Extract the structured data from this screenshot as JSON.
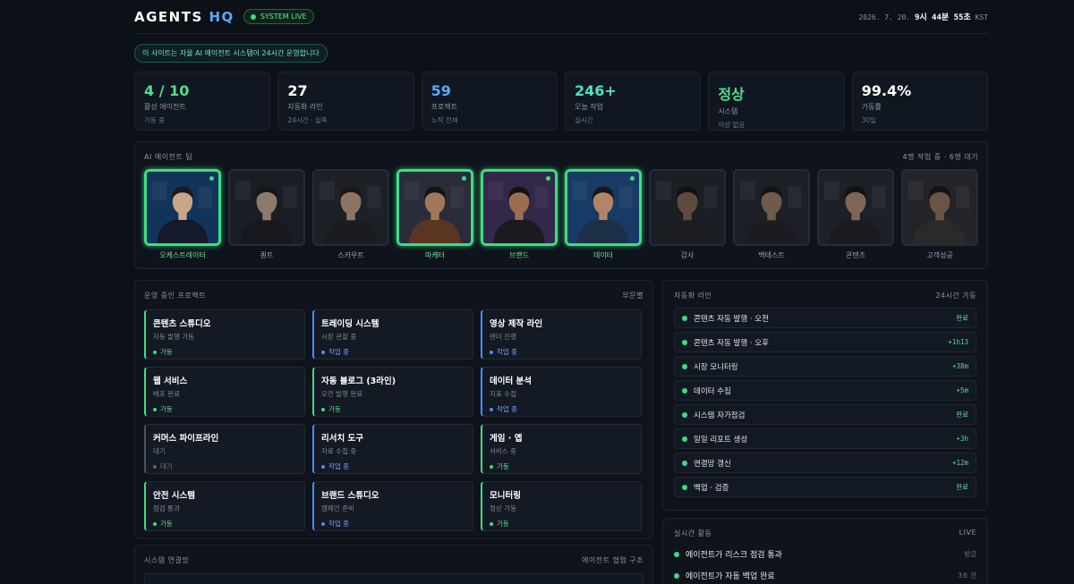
{
  "header": {
    "logo_main": "AGENTS",
    "logo_accent": "HQ",
    "live_badge": "SYSTEM LIVE",
    "clock_date": "2026. 7. 20.",
    "clock_time": "9시 44분 55초",
    "clock_tz": "KST"
  },
  "notice": "이 사이트는 자율 AI 에이전트 시스템이 24시간 운영합니다",
  "kpis": [
    {
      "value": "4 / 10",
      "label": "활성 에이전트",
      "sub": "가동 중",
      "color": "#4fe08c"
    },
    {
      "value": "27",
      "label": "자동화 라인",
      "sub": "24시간 · 실측",
      "color": "#ffffff"
    },
    {
      "value": "59",
      "label": "프로젝트",
      "sub": "누적 전체",
      "color": "#5aa8ff"
    },
    {
      "value": "246+",
      "label": "오늘 작업",
      "sub": "실시간",
      "color": "#4fe0c8"
    },
    {
      "value": "정상",
      "label": "시스템",
      "sub": "이상 없음",
      "color": "#4fe08c"
    },
    {
      "value": "99.4%",
      "label": "가동률",
      "sub": "30일",
      "color": "#ffffff"
    }
  ],
  "agents": {
    "title": "AI 에이전트 팀",
    "summary": "4명 작업 중 · 6명 대기",
    "items": [
      {
        "name": "오케스트레이터",
        "active": true,
        "skin": "#c9a58a",
        "hair": "#1a1a1f",
        "cloth": "#141a2a",
        "bg": "#13345a"
      },
      {
        "name": "퀀트",
        "active": false,
        "skin": "#8e7a6c",
        "hair": "#15161a",
        "cloth": "#16181d",
        "bg": "#1a1d24"
      },
      {
        "name": "스카우트",
        "active": false,
        "skin": "#8d7464",
        "hair": "#1d1715",
        "cloth": "#1a1c20",
        "bg": "#1d2026"
      },
      {
        "name": "마케터",
        "active": true,
        "skin": "#a3785a",
        "hair": "#161413",
        "cloth": "#5a3622",
        "bg": "#2a2c3a"
      },
      {
        "name": "브랜드",
        "active": true,
        "skin": "#9b6e52",
        "hair": "#151312",
        "cloth": "#1b1a1e",
        "bg": "#33284a"
      },
      {
        "name": "데이터",
        "active": true,
        "skin": "#b38566",
        "hair": "#17171a",
        "cloth": "#1d3048",
        "bg": "#173a66"
      },
      {
        "name": "감사",
        "active": false,
        "skin": "#5e4a3e",
        "hair": "#121212",
        "cloth": "#1c1e22",
        "bg": "#1b1e24"
      },
      {
        "name": "백테스트",
        "active": false,
        "skin": "#6f5a4c",
        "hair": "#141416",
        "cloth": "#1a1c21",
        "bg": "#1c1f25"
      },
      {
        "name": "콘텐츠",
        "active": false,
        "skin": "#7d6656",
        "hair": "#121214",
        "cloth": "#191b1f",
        "bg": "#1d2026"
      },
      {
        "name": "고객성공",
        "active": false,
        "skin": "#6a5445",
        "hair": "#131313",
        "cloth": "#2a2a2a",
        "bg": "#22242a"
      }
    ]
  },
  "projects": {
    "title": "운영 중인 프로젝트",
    "filter": "부문별",
    "items": [
      {
        "title": "콘텐츠 스튜디오",
        "desc": "자동 발행 가동",
        "status": "가동",
        "kind": "green"
      },
      {
        "title": "트레이딩 시스템",
        "desc": "시장 관찰 중",
        "status": "작업 중",
        "kind": "blue"
      },
      {
        "title": "영상 제작 라인",
        "desc": "렌더 진행",
        "status": "작업 중",
        "kind": "blue"
      },
      {
        "title": "웹 서비스",
        "desc": "배포 완료",
        "status": "가동",
        "kind": "green"
      },
      {
        "title": "자동 블로그 (3라인)",
        "desc": "오전 발행 완료",
        "status": "가동",
        "kind": "green"
      },
      {
        "title": "데이터 분석",
        "desc": "지표 수집",
        "status": "작업 중",
        "kind": "blue"
      },
      {
        "title": "커머스 파이프라인",
        "desc": "대기",
        "status": "대기",
        "kind": "grey"
      },
      {
        "title": "리서치 도구",
        "desc": "자료 수집 중",
        "status": "작업 중",
        "kind": "blue"
      },
      {
        "title": "게임 · 앱",
        "desc": "서비스 중",
        "status": "가동",
        "kind": "green"
      },
      {
        "title": "안전 시스템",
        "desc": "점검 통과",
        "status": "가동",
        "kind": "green"
      },
      {
        "title": "브랜드 스튜디오",
        "desc": "캠페인 준비",
        "status": "작업 중",
        "kind": "blue"
      },
      {
        "title": "모니터링",
        "desc": "정상 가동",
        "status": "가동",
        "kind": "green"
      }
    ]
  },
  "automation": {
    "title": "자동화 라인",
    "summary": "24시간 가동",
    "items": [
      {
        "label": "콘텐츠 자동 발행 · 오전",
        "value": "완료"
      },
      {
        "label": "콘텐츠 자동 발행 · 오후",
        "value": "+1h13"
      },
      {
        "label": "시장 모니터링",
        "value": "+38m"
      },
      {
        "label": "데이터 수집",
        "value": "+5m"
      },
      {
        "label": "시스템 자가점검",
        "value": "완료"
      },
      {
        "label": "일일 리포트 생성",
        "value": "+3h"
      },
      {
        "label": "연결망 갱신",
        "value": "+12m"
      },
      {
        "label": "백업 · 검증",
        "value": "완료"
      }
    ]
  },
  "activity": {
    "title": "실시간 활동",
    "badge": "LIVE",
    "items": [
      {
        "text": "에이전트가 리스크 점검 통과",
        "time": "방금"
      },
      {
        "text": "에이전트가 자동 백업 완료",
        "time": "3초 전"
      }
    ]
  },
  "network": {
    "title": "시스템 연결망",
    "subtitle": "에이전트 협업 구조"
  }
}
